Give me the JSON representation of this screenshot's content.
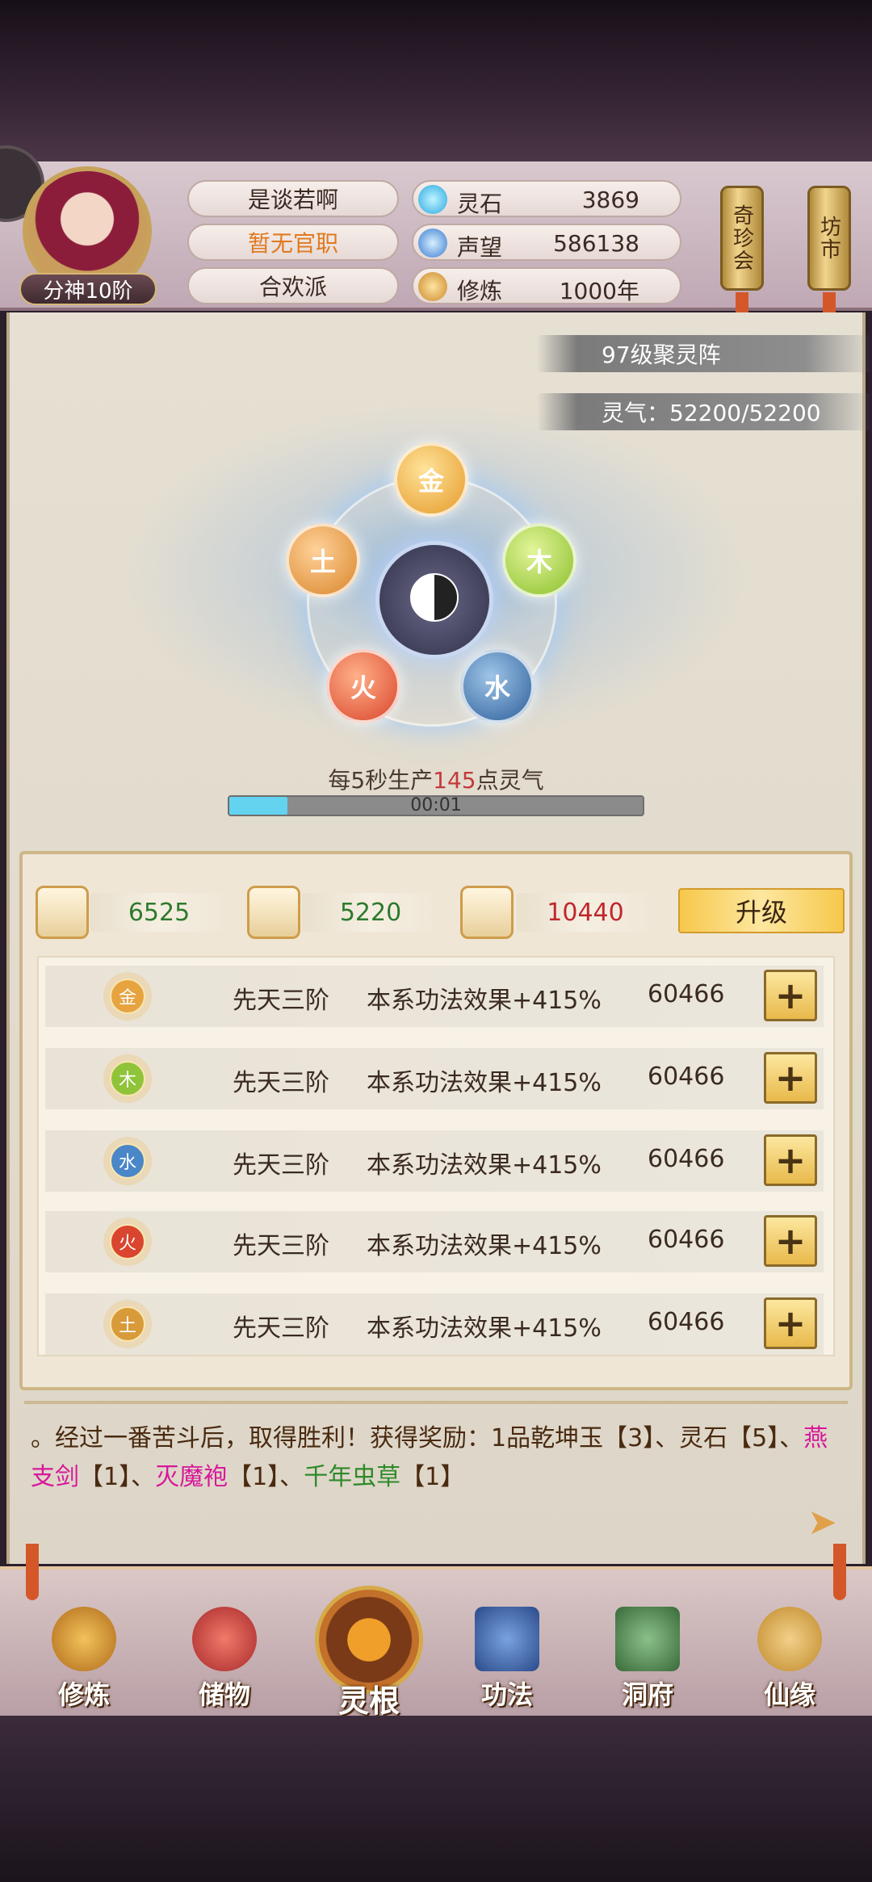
{
  "player": {
    "name": "是谈若啊",
    "office": "暂无官职",
    "sect": "合欢派",
    "rank": "分神10阶"
  },
  "stats": [
    {
      "label": "灵石",
      "value": "3869",
      "icon": "spirit-stone-icon"
    },
    {
      "label": "声望",
      "value": "586138",
      "icon": "prestige-icon"
    },
    {
      "label": "修炼",
      "value": "1000年",
      "icon": "cultivation-icon"
    }
  ],
  "side_buttons": {
    "treasure": "奇珍会",
    "market": "坊市"
  },
  "formation": {
    "level": "97级聚灵阵",
    "qi": "灵气：52200/52200",
    "elements": {
      "gold": "金",
      "wood": "木",
      "water": "水",
      "fire": "火",
      "earth": "土"
    },
    "production_prefix": "每5秒生产",
    "production_amount": "145",
    "production_suffix": "点灵气",
    "timer": "00:01",
    "timer_progress": 0.14
  },
  "resources": [
    {
      "value": "6525",
      "color": "#2d7a2d",
      "icon": "ore-icon"
    },
    {
      "value": "5220",
      "color": "#2d7a2d",
      "icon": "wood-logs-icon"
    },
    {
      "value": "10440",
      "color": "#c0272d",
      "icon": "herb-icon"
    }
  ],
  "upgrade_label": "升级",
  "spirit_roots": [
    {
      "element": "金",
      "grade": "先天三阶",
      "effect": "本系功法效果+415%",
      "cost": "60466",
      "color": "#e6a340"
    },
    {
      "element": "木",
      "grade": "先天三阶",
      "effect": "本系功法效果+415%",
      "cost": "60466",
      "color": "#8fc43a"
    },
    {
      "element": "水",
      "grade": "先天三阶",
      "effect": "本系功法效果+415%",
      "cost": "60466",
      "color": "#4a86c8"
    },
    {
      "element": "火",
      "grade": "先天三阶",
      "effect": "本系功法效果+415%",
      "cost": "60466",
      "color": "#d9452f"
    },
    {
      "element": "土",
      "grade": "先天三阶",
      "effect": "本系功法效果+415%",
      "cost": "60466",
      "color": "#d99a3a"
    }
  ],
  "plus_label": "+",
  "log": {
    "part1": "。经过一番苦斗后，取得胜利！获得奖励：1品乾坤玉【3】、灵石【5】、",
    "item1": "燕支剑",
    "part2": "【1】、",
    "item2": "灭魔袍",
    "part3": "【1】、",
    "item3": "千年虫草",
    "part4": "【1】"
  },
  "nav": {
    "cultivate": "修炼",
    "storage": "储物",
    "spirit_root": "灵根",
    "techniques": "功法",
    "cave": "洞府",
    "fate": "仙缘"
  }
}
